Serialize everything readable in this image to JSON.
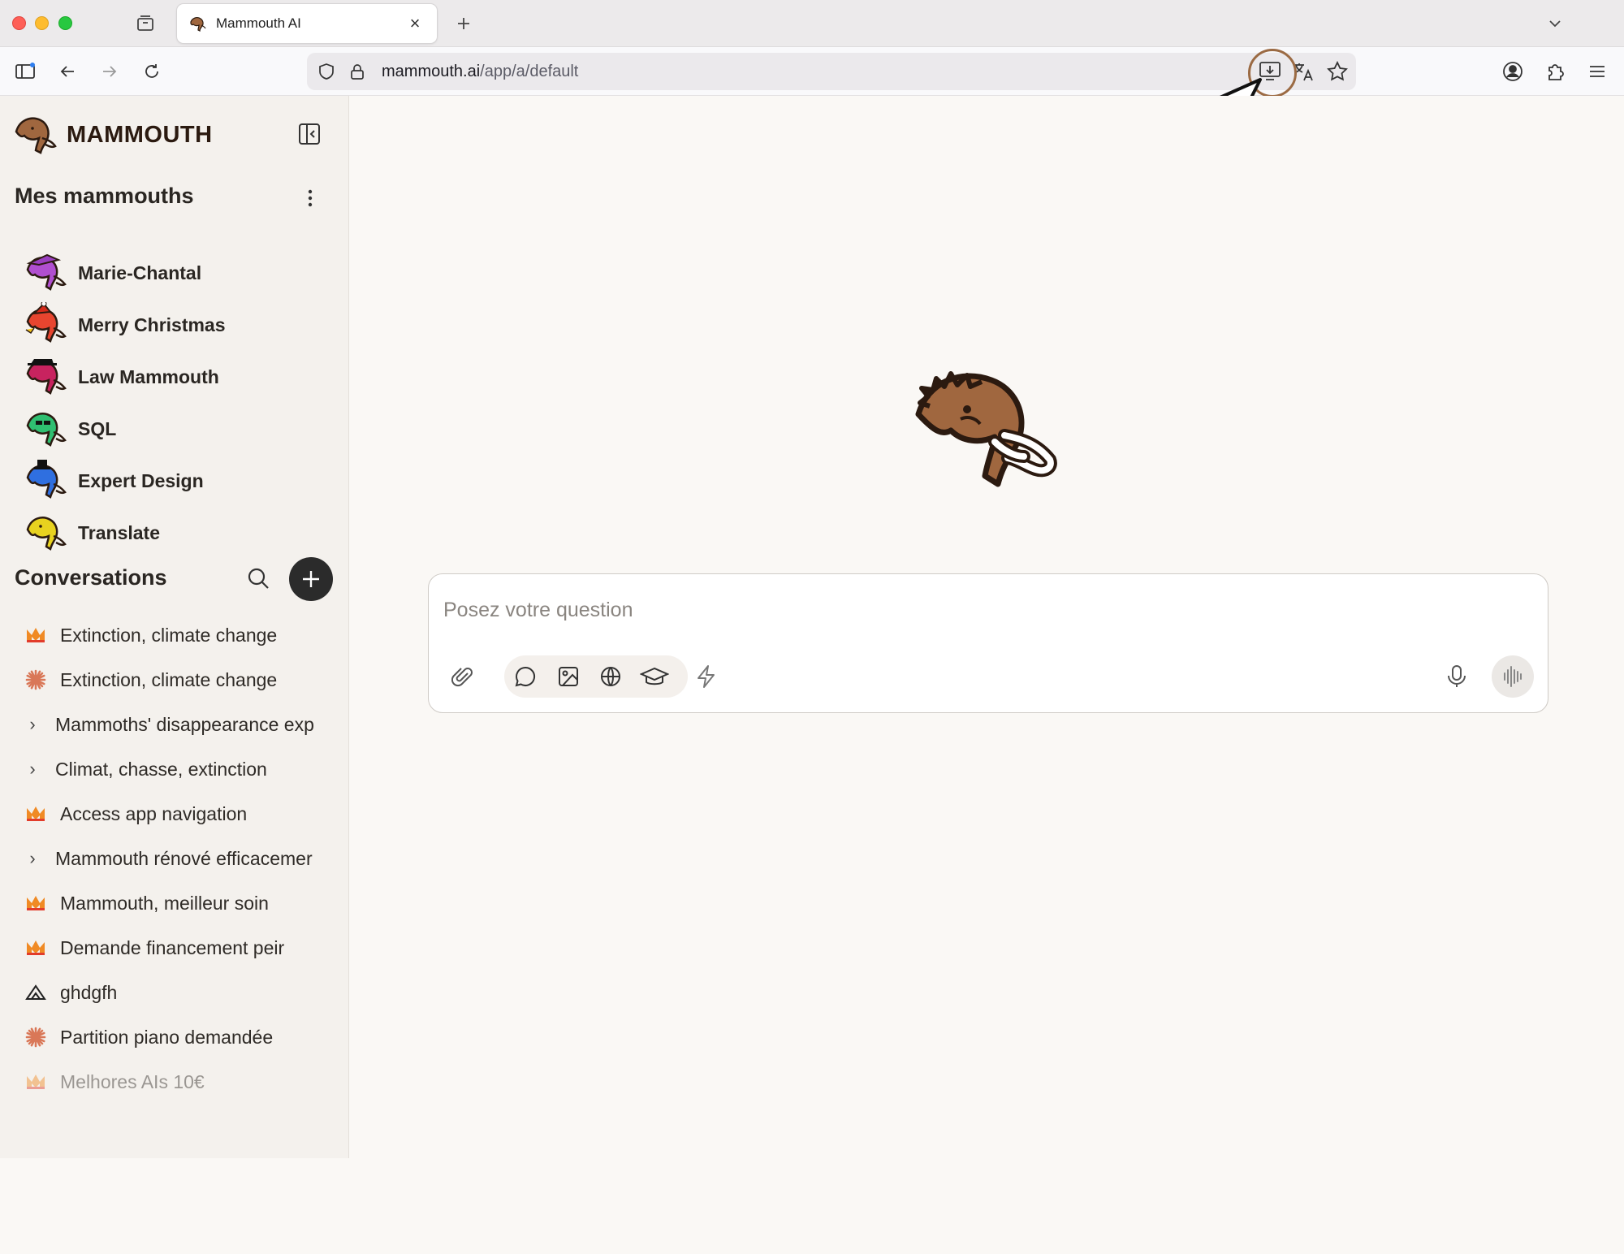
{
  "browser": {
    "tab_title": "Mammouth AI",
    "url_host": "mammouth.ai",
    "url_path": "/app/a/default"
  },
  "sidebar": {
    "brand": "MAMMOUTH",
    "assistants_title": "Mes mammouths",
    "assistants": [
      {
        "label": "Marie-Chantal",
        "color": "#b04fd0"
      },
      {
        "label": "Merry Christmas",
        "color": "#e8452f"
      },
      {
        "label": "Law Mammouth",
        "color": "#c8235f"
      },
      {
        "label": "SQL",
        "color": "#2fbf71"
      },
      {
        "label": "Expert Design",
        "color": "#2f6fe0"
      },
      {
        "label": "Translate",
        "color": "#e8d21f"
      }
    ],
    "conversations_title": "Conversations",
    "conversations": [
      {
        "label": "Extinction, climate change",
        "icon": "mammouth-logo-icon"
      },
      {
        "label": "Extinction, climate change",
        "icon": "claude-burst-icon"
      },
      {
        "label": "Mammoths' disappearance exp",
        "icon": "chevron-right-icon"
      },
      {
        "label": "Climat, chasse, extinction",
        "icon": "chevron-right-icon"
      },
      {
        "label": "Access app navigation",
        "icon": "mammouth-logo-icon"
      },
      {
        "label": "Mammouth rénové efficacemer",
        "icon": "chevron-right-icon"
      },
      {
        "label": "Mammouth, meilleur soin",
        "icon": "mammouth-logo-icon"
      },
      {
        "label": "Demande financement peir",
        "icon": "mammouth-logo-icon"
      },
      {
        "label": "ghdgfh",
        "icon": "mountain-logo-icon"
      },
      {
        "label": "Partition piano demandée",
        "icon": "claude-burst-icon"
      },
      {
        "label": "Melhores AIs 10€",
        "icon": "mammouth-logo-icon"
      }
    ]
  },
  "composer": {
    "placeholder": "Posez votre question"
  },
  "colors": {
    "mammoth_brown": "#a0673f",
    "accent_orange": "#f08a24",
    "claude_orange": "#d97757"
  }
}
